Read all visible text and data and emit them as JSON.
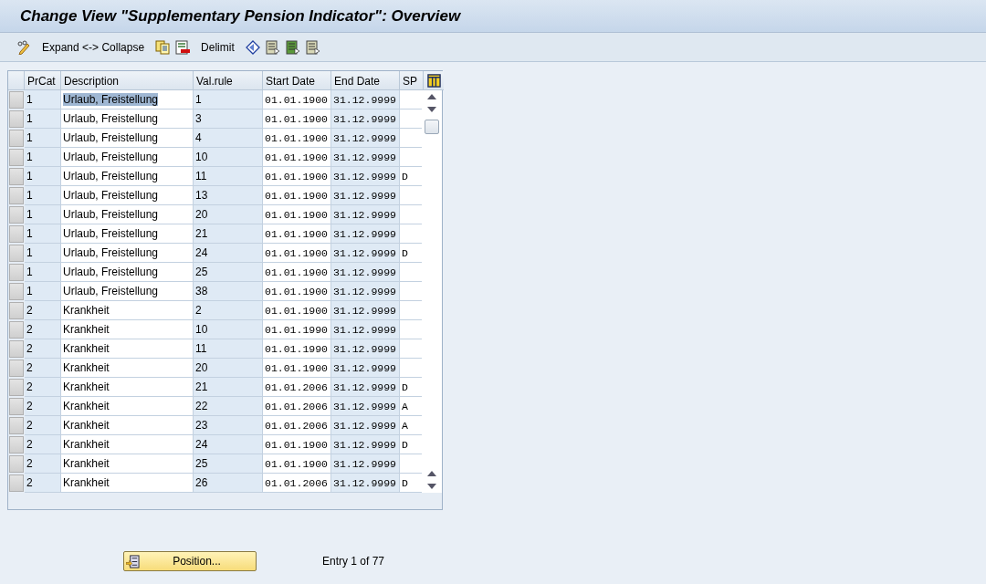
{
  "window": {
    "title": "Change View \"Supplementary Pension Indicator\": Overview"
  },
  "toolbar": [
    {
      "kind": "icon"
    },
    {
      "kind": "text",
      "label": "Expand <-> Collapse"
    },
    {
      "kind": "icon"
    },
    {
      "kind": "icon"
    },
    {
      "kind": "text",
      "label": "Delimit"
    },
    {
      "kind": "icon"
    },
    {
      "kind": "icon"
    },
    {
      "kind": "icon"
    },
    {
      "kind": "icon"
    }
  ],
  "table": {
    "columns": [
      "PrCat",
      "Description",
      "Val.rule",
      "Start Date",
      "End Date",
      "SP"
    ],
    "rows": [
      {
        "prcat": "1",
        "description": "Urlaub, Freistellung",
        "val_rule": "1",
        "start": "01.01.1900",
        "end": "31.12.9999",
        "selected": true
      },
      {
        "prcat": "1",
        "description": "Urlaub, Freistellung",
        "val_rule": "3",
        "start": "01.01.1900",
        "end": "31.12.9999",
        "selected": false
      },
      {
        "prcat": "1",
        "description": "Urlaub, Freistellung",
        "val_rule": "4",
        "start": "01.01.1900",
        "end": "31.12.9999",
        "selected": false
      },
      {
        "prcat": "1",
        "description": "Urlaub, Freistellung",
        "val_rule": "10",
        "start": "01.01.1900",
        "end": "31.12.9999",
        "selected": false
      },
      {
        "prcat": "1",
        "description": "Urlaub, Freistellung",
        "val_rule": "11",
        "start": "01.01.1900",
        "end": "31.12.9999",
        "sp": "D",
        "selected": false
      },
      {
        "prcat": "1",
        "description": "Urlaub, Freistellung",
        "val_rule": "13",
        "start": "01.01.1900",
        "end": "31.12.9999",
        "selected": false
      },
      {
        "prcat": "1",
        "description": "Urlaub, Freistellung",
        "val_rule": "20",
        "start": "01.01.1900",
        "end": "31.12.9999",
        "selected": false
      },
      {
        "prcat": "1",
        "description": "Urlaub, Freistellung",
        "val_rule": "21",
        "start": "01.01.1900",
        "end": "31.12.9999",
        "selected": false
      },
      {
        "prcat": "1",
        "description": "Urlaub, Freistellung",
        "val_rule": "24",
        "start": "01.01.1900",
        "end": "31.12.9999",
        "sp": "D",
        "selected": false
      },
      {
        "prcat": "1",
        "description": "Urlaub, Freistellung",
        "val_rule": "25",
        "start": "01.01.1900",
        "end": "31.12.9999",
        "selected": false
      },
      {
        "prcat": "1",
        "description": "Urlaub, Freistellung",
        "val_rule": "38",
        "start": "01.01.1900",
        "end": "31.12.9999",
        "selected": false
      },
      {
        "prcat": "2",
        "description": "Krankheit",
        "val_rule": "2",
        "start": "01.01.1900",
        "end": "31.12.9999",
        "selected": false
      },
      {
        "prcat": "2",
        "description": "Krankheit",
        "val_rule": "10",
        "start": "01.01.1990",
        "end": "31.12.9999",
        "selected": false
      },
      {
        "prcat": "2",
        "description": "Krankheit",
        "val_rule": "11",
        "start": "01.01.1990",
        "end": "31.12.9999",
        "selected": false
      },
      {
        "prcat": "2",
        "description": "Krankheit",
        "val_rule": "20",
        "start": "01.01.1900",
        "end": "31.12.9999",
        "selected": false
      },
      {
        "prcat": "2",
        "description": "Krankheit",
        "val_rule": "21",
        "start": "01.01.2006",
        "end": "31.12.9999",
        "sp": "D",
        "selected": false
      },
      {
        "prcat": "2",
        "description": "Krankheit",
        "val_rule": "22",
        "start": "01.01.2006",
        "end": "31.12.9999",
        "sp": "A",
        "selected": false
      },
      {
        "prcat": "2",
        "description": "Krankheit",
        "val_rule": "23",
        "start": "01.01.2006",
        "end": "31.12.9999",
        "sp": "A",
        "selected": false
      },
      {
        "prcat": "2",
        "description": "Krankheit",
        "val_rule": "24",
        "start": "01.01.1900",
        "end": "31.12.9999",
        "sp": "D",
        "selected": false
      },
      {
        "prcat": "2",
        "description": "Krankheit",
        "val_rule": "25",
        "start": "01.01.1900",
        "end": "31.12.9999",
        "selected": false
      },
      {
        "prcat": "2",
        "description": "Krankheit",
        "val_rule": "26",
        "start": "01.01.2006",
        "end": "31.12.9999",
        "sp": "D",
        "selected": false
      }
    ]
  },
  "position_button": {
    "label": "Position..."
  },
  "entry_info": "Entry 1 of 77"
}
